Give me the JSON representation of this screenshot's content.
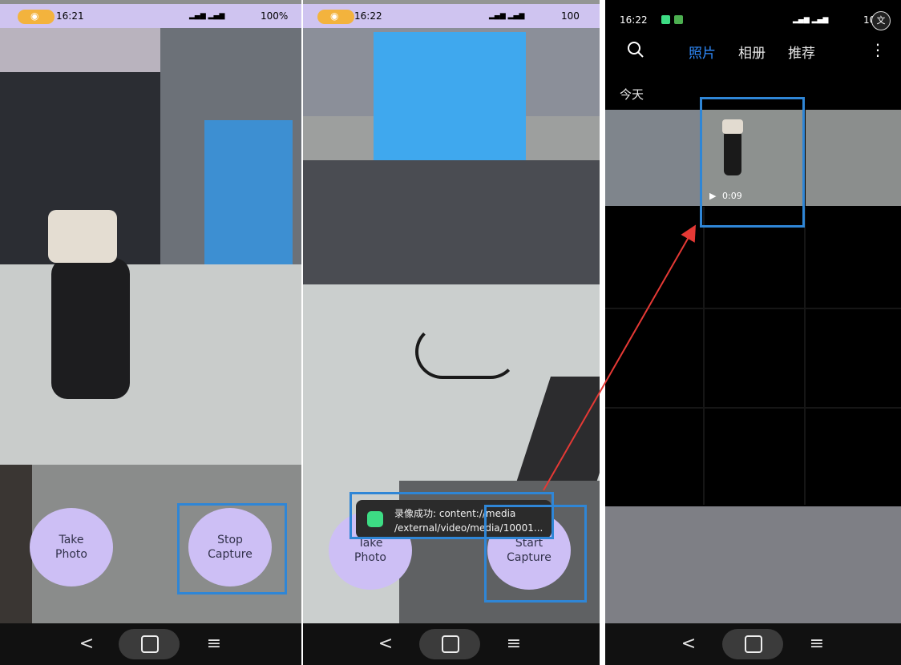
{
  "panel1": {
    "status": {
      "time": "16:21",
      "signal": "▂▄▆ ▂▄▆",
      "battery": "100%"
    },
    "buttons": {
      "take_photo": "Take\nPhoto",
      "stop_capture": "Stop\nCapture"
    }
  },
  "panel2": {
    "status": {
      "time": "16:22",
      "signal": "▂▄▆ ▂▄▆",
      "battery": "100"
    },
    "toast": {
      "line1": "录像成功: content://media",
      "line2": "/external/video/media/10001..."
    },
    "buttons": {
      "take_photo": "Take\nPhoto",
      "start_capture": "Start\nCapture"
    }
  },
  "panel3": {
    "status": {
      "time": "16:22",
      "signal": "▂▄▆ ▂▄▆",
      "battery": "10"
    },
    "tabs": [
      "照片",
      "相册",
      "推荐"
    ],
    "section_label": "今天",
    "video_duration": "0:09",
    "accent": "#2f8cff"
  },
  "nav": {
    "back": "<",
    "menu": "≡"
  }
}
